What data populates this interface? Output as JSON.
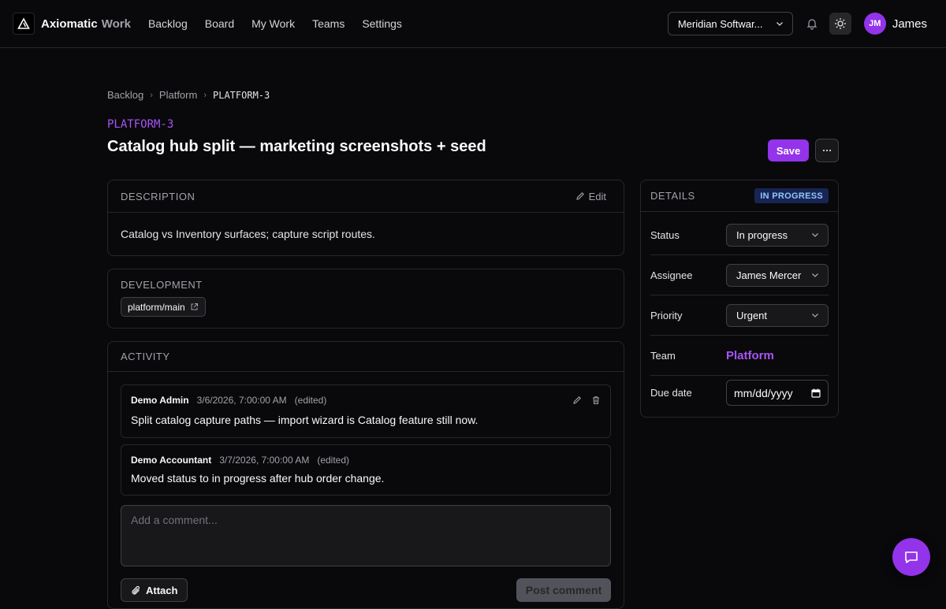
{
  "app": {
    "brand": "Axiomatic",
    "brand_sub": "Work"
  },
  "nav": {
    "items": [
      {
        "label": "Backlog"
      },
      {
        "label": "Board"
      },
      {
        "label": "My Work"
      },
      {
        "label": "Teams"
      },
      {
        "label": "Settings"
      }
    ]
  },
  "topbar": {
    "org": "Meridian Softwar...",
    "avatar_initials": "JM",
    "user_name": "James"
  },
  "breadcrumb": {
    "items": [
      "Backlog",
      "Platform",
      "PLATFORM-3"
    ]
  },
  "issue": {
    "key": "PLATFORM-3",
    "title": "Catalog hub split — marketing screenshots + seed",
    "save_label": "Save"
  },
  "description": {
    "heading": "DESCRIPTION",
    "edit_label": "Edit",
    "body": "Catalog vs Inventory surfaces; capture script routes."
  },
  "development": {
    "heading": "DEVELOPMENT",
    "branch": "platform/main"
  },
  "activity": {
    "heading": "ACTIVITY",
    "comments": [
      {
        "author": "Demo Admin",
        "timestamp": "3/6/2026, 7:00:00 AM",
        "edited": "(edited)",
        "text": "Split catalog capture paths — import wizard is Catalog feature still now."
      },
      {
        "author": "Demo Accountant",
        "timestamp": "3/7/2026, 7:00:00 AM",
        "edited": "(edited)",
        "text": "Moved status to in progress after hub order change."
      }
    ],
    "comment_placeholder": "Add a comment...",
    "attach_label": "Attach",
    "post_label": "Post comment"
  },
  "details": {
    "heading": "DETAILS",
    "status_badge": "IN PROGRESS",
    "status_label": "Status",
    "status_value": "In progress",
    "assignee_label": "Assignee",
    "assignee_value": "James Mercer",
    "priority_label": "Priority",
    "priority_value": "Urgent",
    "team_label": "Team",
    "team_value": "Platform",
    "due_label": "Due date",
    "due_value": "mm/dd/yyyy"
  },
  "colors": {
    "accent": "#9333ea",
    "accent_text": "#a855f7",
    "badge_bg": "#172554",
    "badge_text": "#93c5fd",
    "background": "#09090b"
  }
}
